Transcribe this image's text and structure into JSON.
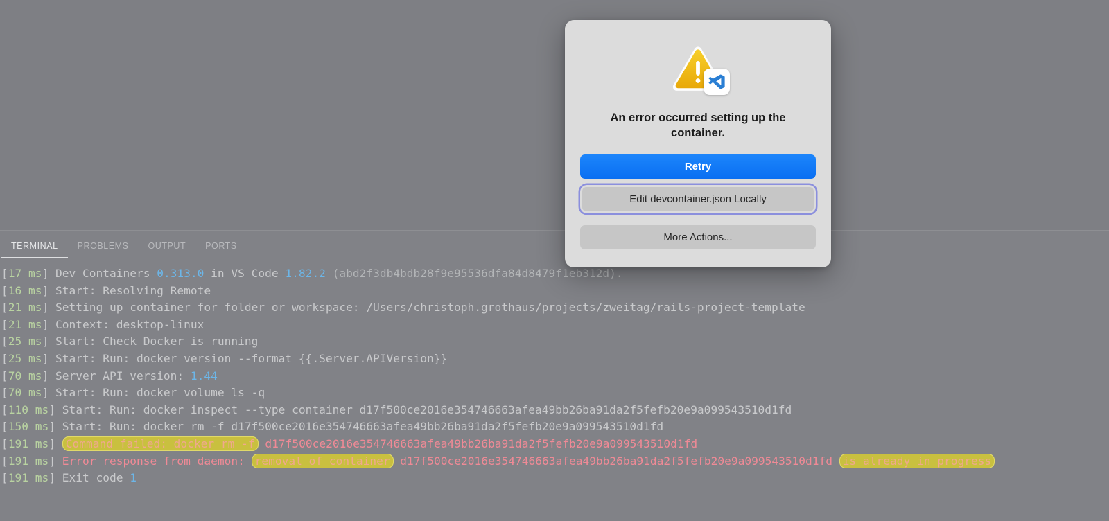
{
  "panel": {
    "tabs": [
      {
        "label": "TERMINAL",
        "active": true
      },
      {
        "label": "PROBLEMS",
        "active": false
      },
      {
        "label": "OUTPUT",
        "active": false
      },
      {
        "label": "PORTS",
        "active": false
      }
    ]
  },
  "dialog": {
    "icon": "warning-triangle-with-vscode-badge",
    "title": "An error occurred setting up the container.",
    "buttons": {
      "retry": "Retry",
      "edit_locally": "Edit devcontainer.json Locally",
      "more_actions": "More Actions..."
    },
    "accent_color": "#0a6ff2",
    "focus_ring_color": "#8b8fdd",
    "warning_color": "#eeb90d"
  },
  "terminal": {
    "container_id": "d17f500ce2016e354746663afea49bb26ba91da2f5fefb20e9a099543510d1fd",
    "workspace_path": "/Users/christoph.grothaus/projects/zweitag/rails-project-template",
    "lines": [
      {
        "time": "17",
        "unit": "ms",
        "parts": [
          {
            "t": "Dev Containers ",
            "c": "txt"
          },
          {
            "t": "0.313.0",
            "c": "num"
          },
          {
            "t": " in VS Code ",
            "c": "txt"
          },
          {
            "t": "1.82.2",
            "c": "num"
          },
          {
            "t": " (abd2f3db4bdb28f9e95536dfa84d8479f1eb312d).",
            "c": "dim"
          }
        ]
      },
      {
        "time": "16",
        "unit": "ms",
        "parts": [
          {
            "t": "Start: Resolving Remote",
            "c": "txt"
          }
        ]
      },
      {
        "time": "21",
        "unit": "ms",
        "parts": [
          {
            "t": "Setting up container for folder or workspace: /Users/christoph.grothaus/projects/zweitag/rails-project-template",
            "c": "txt"
          }
        ]
      },
      {
        "time": "21",
        "unit": "ms",
        "parts": [
          {
            "t": "Context: desktop-linux",
            "c": "txt"
          }
        ]
      },
      {
        "time": "25",
        "unit": "ms",
        "parts": [
          {
            "t": "Start: Check Docker is running",
            "c": "txt"
          }
        ]
      },
      {
        "time": "25",
        "unit": "ms",
        "parts": [
          {
            "t": "Start: Run: docker version --format {{.Server.APIVersion}}",
            "c": "txt"
          }
        ]
      },
      {
        "time": "70",
        "unit": "ms",
        "parts": [
          {
            "t": "Server API version: ",
            "c": "txt"
          },
          {
            "t": "1.44",
            "c": "num"
          }
        ]
      },
      {
        "time": "70",
        "unit": "ms",
        "parts": [
          {
            "t": "Start: Run: docker volume ls -q",
            "c": "txt"
          }
        ]
      },
      {
        "time": "110",
        "unit": "ms",
        "parts": [
          {
            "t": "Start: Run: docker inspect --type container d17f500ce2016e354746663afea49bb26ba91da2f5fefb20e9a099543510d1fd",
            "c": "txt"
          }
        ]
      },
      {
        "time": "150",
        "unit": "ms",
        "parts": [
          {
            "t": "Start: Run: docker rm -f d17f500ce2016e354746663afea49bb26ba91da2f5fefb20e9a099543510d1fd",
            "c": "txt"
          }
        ]
      },
      {
        "time": "191",
        "unit": "ms",
        "parts": [
          {
            "t": "Command failed: docker rm -f",
            "c": "hl"
          },
          {
            "t": " ",
            "c": "err"
          },
          {
            "t": "d17f500ce2016e354746663afea49bb26ba91da2f5fefb20e9a099543510d1fd",
            "c": "err"
          }
        ]
      },
      {
        "time": "191",
        "unit": "ms",
        "parts": [
          {
            "t": "Error response from daemon: ",
            "c": "err"
          },
          {
            "t": "removal of container",
            "c": "hl"
          },
          {
            "t": " d17f500ce2016e354746663afea49bb26ba91da2f5fefb20e9a099543510d1fd ",
            "c": "err"
          },
          {
            "t": "is already in progress",
            "c": "hl"
          }
        ]
      },
      {
        "time": "191",
        "unit": "ms",
        "parts": [
          {
            "t": "Exit code ",
            "c": "txt"
          },
          {
            "t": "1",
            "c": "num"
          }
        ]
      }
    ]
  }
}
